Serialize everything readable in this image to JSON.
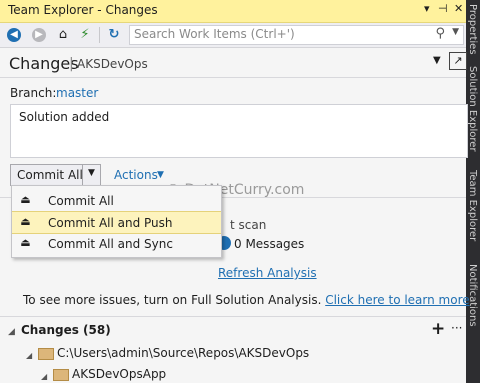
{
  "window": {
    "title": "Team Explorer - Changes"
  },
  "toolbar": {
    "search_placeholder": "Search Work Items (Ctrl+')"
  },
  "header": {
    "title": "Changes",
    "separator": "|",
    "project": "AKSDevOps"
  },
  "branch": {
    "label": "Branch:",
    "value": "master"
  },
  "commit_message": "Solution added",
  "commit_button": {
    "label": "Commit All"
  },
  "actions": {
    "label": "Actions"
  },
  "menu": {
    "items": [
      {
        "label": "Commit All"
      },
      {
        "label": "Commit All and Push"
      },
      {
        "label": "Commit All and Sync"
      }
    ],
    "highlighted_index": 1
  },
  "analysis": {
    "last_scan": "t scan",
    "messages": "0 Messages",
    "refresh": "Refresh Analysis"
  },
  "full_solution": {
    "text": "To see more issues, turn on Full Solution Analysis.",
    "link": "Click here to learn more"
  },
  "changes": {
    "label": "Changes (58)",
    "path": "C:\\Users\\admin\\Source\\Repos\\AKSDevOps",
    "subfolder": "AKSDevOpsApp"
  },
  "right_strip": {
    "labels": [
      "Properties",
      "Solution Explorer",
      "Team Explorer",
      "Notifications"
    ]
  },
  "watermark": "© DotNetCurry.com",
  "colors": {
    "title_bar": "#fff29d",
    "link": "#1f6fb2",
    "menu_highlight": "#fdf3bd"
  }
}
